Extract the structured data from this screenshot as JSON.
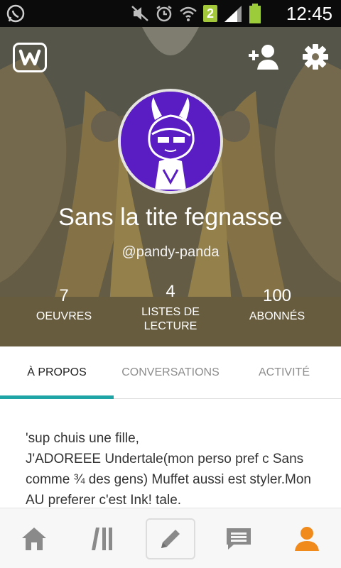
{
  "status_bar": {
    "time": "12:45",
    "sim_slot": "2"
  },
  "header": {
    "display_name": "Sans la tite fegnasse",
    "username": "@pandy-panda",
    "stats": [
      {
        "value": "7",
        "label": "OEUVRES"
      },
      {
        "value": "4",
        "label": "LISTES DE LECTURE"
      },
      {
        "value": "100",
        "label": "ABONNÉS"
      }
    ]
  },
  "tabs": [
    {
      "label": "À PROPOS",
      "active": true
    },
    {
      "label": "CONVERSATIONS",
      "active": false
    },
    {
      "label": "ACTIVITÉ",
      "active": false
    }
  ],
  "about": {
    "text": "'sup chuis une fille,\nJ'ADOREEE Undertale(mon perso pref c Sans comme ¾ des gens) Muffet aussi est styler.Mon AU preferer c'est Ink! tale."
  },
  "bottom_nav": [
    "home-icon",
    "library-icon",
    "write-icon",
    "messages-icon",
    "profile-icon"
  ],
  "colors": {
    "accent_teal": "#1fa5a5",
    "accent_orange": "#f08a1d",
    "avatar_purple": "#5a1dc4",
    "sim_green": "#a3c93a"
  }
}
